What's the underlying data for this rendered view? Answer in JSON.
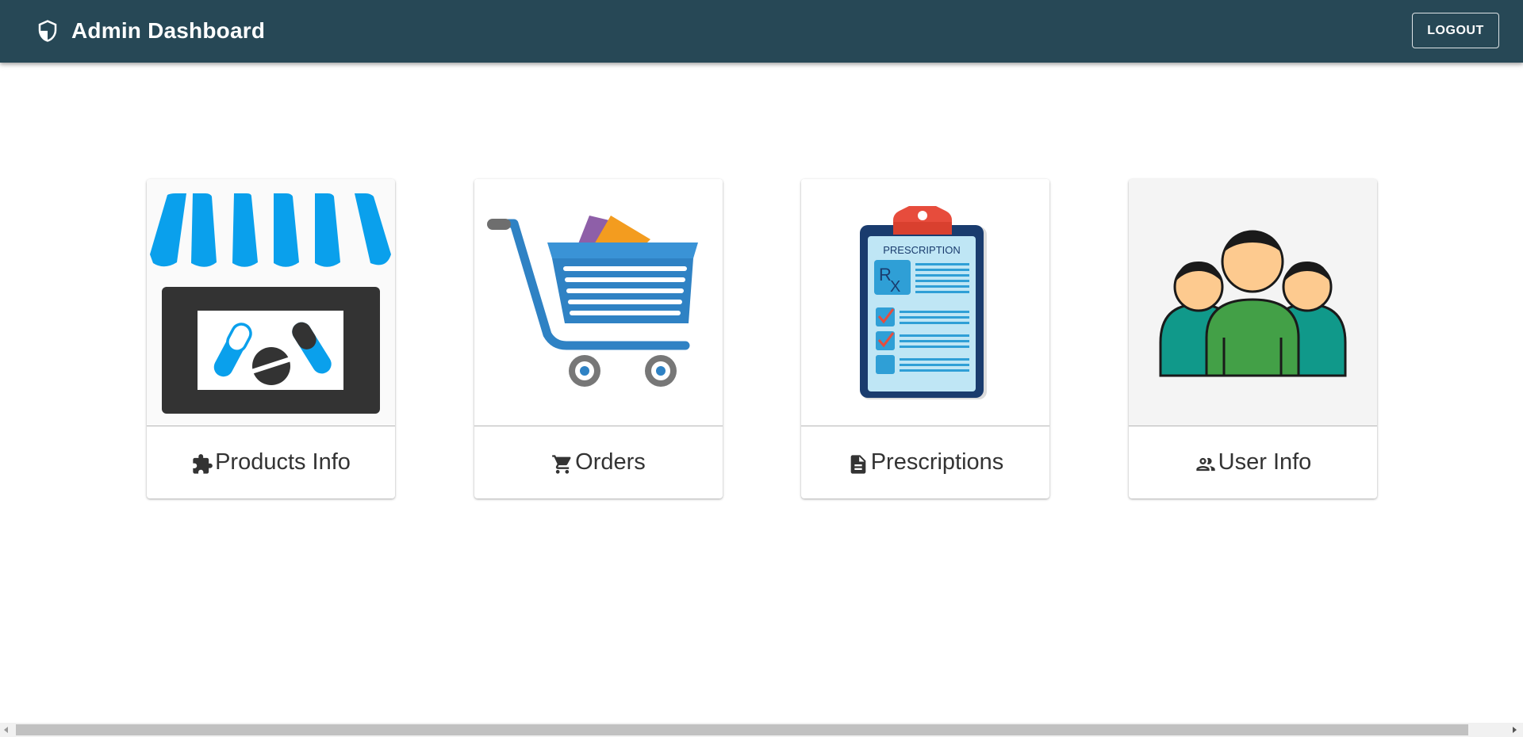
{
  "header": {
    "title": "Admin Dashboard",
    "brand_icon": "shield-icon",
    "logout_label": "LOGOUT",
    "background": "#274856"
  },
  "cards": [
    {
      "label": "Products Info",
      "icon": "puzzle-icon",
      "image": "pharmacy-store-image"
    },
    {
      "label": "Orders",
      "icon": "cart-icon",
      "image": "shopping-cart-image"
    },
    {
      "label": "Prescriptions",
      "icon": "document-icon",
      "image": "prescription-clipboard-image"
    },
    {
      "label": "User Info",
      "icon": "users-icon",
      "image": "user-group-image"
    }
  ]
}
